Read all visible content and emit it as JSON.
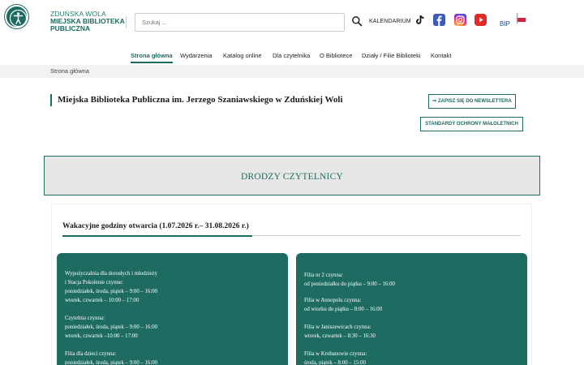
{
  "header": {
    "logo_line1": "ZDUŃSKA WOLA",
    "logo_line2": "MIEJSKA BIBLIOTEKA",
    "logo_line3": "PUBLICZNA",
    "search_placeholder": "Szukaj ...",
    "kalendarium": "KALENDARIUM",
    "bip": "BIP"
  },
  "nav": {
    "items": [
      "Strona główna",
      "Wydarzenia",
      "Katalog online",
      "Dla czytelnika",
      "O Bibliotece",
      "Działy / Filie Biblioteki",
      "Kontakt"
    ]
  },
  "breadcrumb": "Strona główna",
  "page_title": "Miejska Biblioteka Publiczna im. Jerzego Szaniawskiego w Zduńskiej Woli",
  "buttons": {
    "newsletter": "⇨ ZAPISZ SIĘ DO NEWSLETTERA",
    "standardy": "STANDARDY OCHRONY MAŁOLETNICH"
  },
  "hero_title": "DRODZY CZYTELNICY",
  "section_heading": "Wakacyjne godziny otwarcia (1.07.2026 r.– 31.08.2026 r.)",
  "left_card": {
    "h1": "Wypożyczalnia dla dorosłych i młodzieży",
    "h1b": "i Stacja Pokolenie czynne:",
    "l1": "poniedziałek, środa, piątek – 9:00 – 16:00",
    "l2": "wtorek, czwartek – 10:00 – 17:00",
    "h2": "Czytelnia czynna:",
    "l3": "poniedziałek, środa, piątek – 9:00 – 16:00",
    "l4": "wtorek, czwartek –10:00 – 17:00",
    "h3": "Filia dla dzieci czynna:",
    "l5": "poniedziałek, środa, piątek – 9:00 – 16:00"
  },
  "right_card": {
    "h1": "Filia nr 2 czynna:",
    "l1": "od poniedziałku do piątku – 9:00 – 16:00",
    "h2": "Filia w Annopolu czynna:",
    "l2": "od wtorku do piątku – 8:00 – 16:00",
    "h3": "Filia w Janiszewicach czynna:",
    "l3": "wtorek, czwartek – 8:30 – 16:30",
    "h4": "Filia w Krobanowie czynna:",
    "l4": "środa, piątek – 8:00 – 15:00"
  },
  "colors": {
    "brand": "#1e6b62",
    "hero_bg": "#e7e7e7",
    "breadcrumb_bg": "#f2f2f2"
  }
}
